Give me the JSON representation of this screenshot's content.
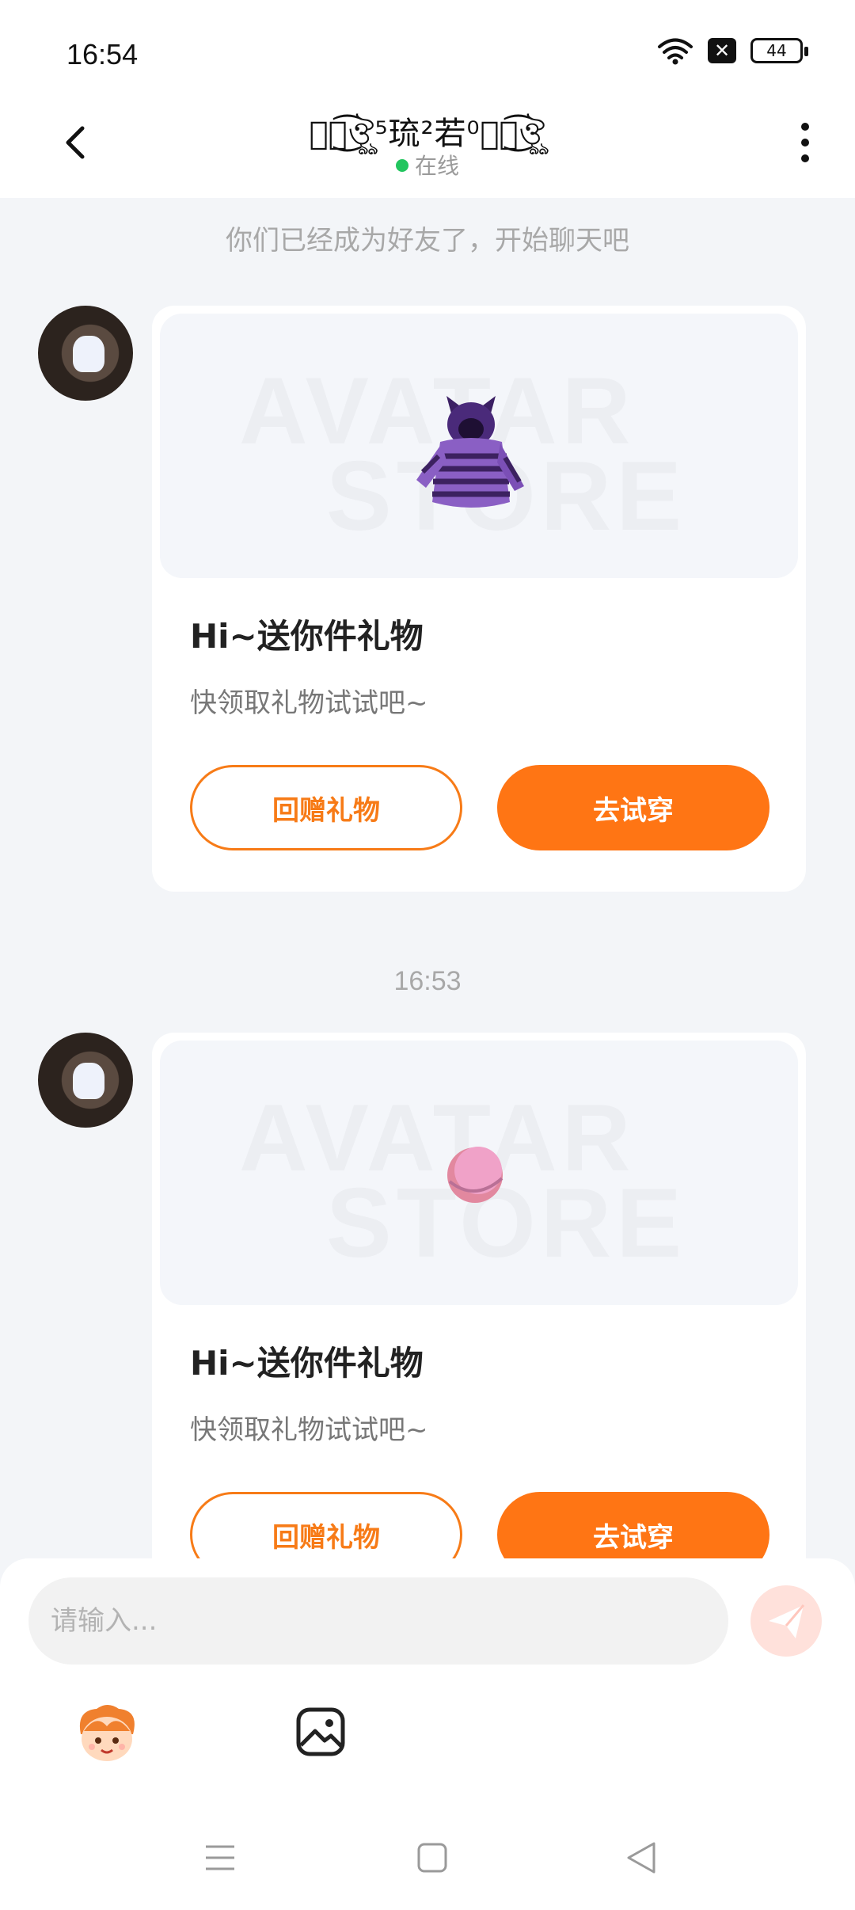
{
  "status_bar": {
    "time": "16:54",
    "battery": "44",
    "icons": [
      "wifi-icon",
      "notification-x-icon",
      "battery-icon"
    ]
  },
  "header": {
    "title": "ঔৣ͜͡ঔৣ⁵琉²若⁰ঔৣ͜͡ঔৣ",
    "presence": "在线",
    "presence_color": "#22c55e"
  },
  "chat": {
    "system_note": "你们已经成为好友了，开始聊天吧",
    "timestamp": "16:53",
    "messages": [
      {
        "gift_item": "purple-striped-cat-hoodie",
        "watermark_line1": "AVATAR",
        "watermark_line2": "STORE",
        "title": "Hi~送你件礼物",
        "subtitle": "快领取礼物试试吧~",
        "secondary_button": "回赠礼物",
        "primary_button": "去试穿"
      },
      {
        "gift_item": "pink-ball",
        "watermark_line1": "AVATAR",
        "watermark_line2": "STORE",
        "title": "Hi~送你件礼物",
        "subtitle": "快领取礼物试试吧~",
        "secondary_button": "回赠礼物",
        "primary_button": "去试穿"
      }
    ]
  },
  "composer": {
    "placeholder": "请输入...",
    "value": "",
    "send_icon": "paper-plane-icon",
    "tools": [
      "mascot-sticker-icon",
      "image-gallery-icon"
    ]
  },
  "colors": {
    "accent": "#ff7514",
    "background": "#f3f5f8"
  }
}
